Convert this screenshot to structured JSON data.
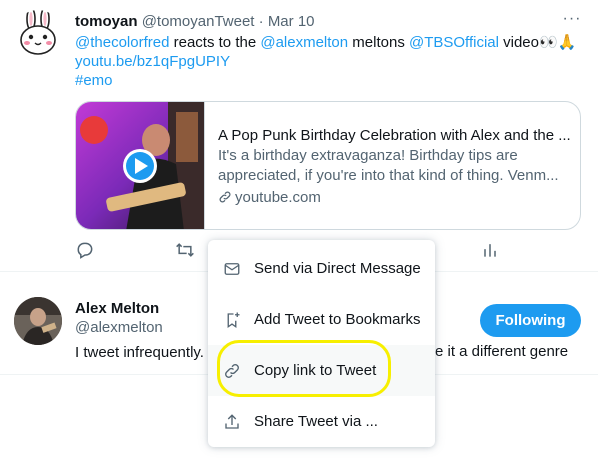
{
  "tweet": {
    "author_name": "tomoyan",
    "author_handle": "@tomoyanTweet",
    "separator": "·",
    "date": "Mar 10",
    "more_label": "···",
    "mention1": "@thecolorfred",
    "text1": " reacts to the ",
    "mention2": "@alexmelton",
    "text2": " meltons ",
    "mention3": "@TBSOfficial",
    "text3": " video👀🙏",
    "url": "youtu.be/bz1qFpgUPIY",
    "hashtag": "#emo",
    "card": {
      "title": "A Pop Punk Birthday Celebration with Alex and the ...",
      "description": "It's a birthday extravaganza! Birthday tips are appreciated, if you're into that kind of thing. Venm...",
      "domain": "youtube.com"
    }
  },
  "tweet2": {
    "name": "Alex Melton",
    "handle": "@alexmelton",
    "bio_left": "I tweet infrequently.",
    "bio_right": "e it a different genre",
    "follow_label": "Following"
  },
  "menu": {
    "items": [
      {
        "label": "Send via Direct Message",
        "icon": "envelope-icon"
      },
      {
        "label": "Add Tweet to Bookmarks",
        "icon": "bookmark-add-icon"
      },
      {
        "label": "Copy link to Tweet",
        "icon": "link-icon"
      },
      {
        "label": "Share Tweet via ...",
        "icon": "share-icon"
      }
    ]
  },
  "colors": {
    "accent": "#1d9bf0",
    "highlight_ring": "#f7ef00",
    "secondary_text": "#536471"
  }
}
